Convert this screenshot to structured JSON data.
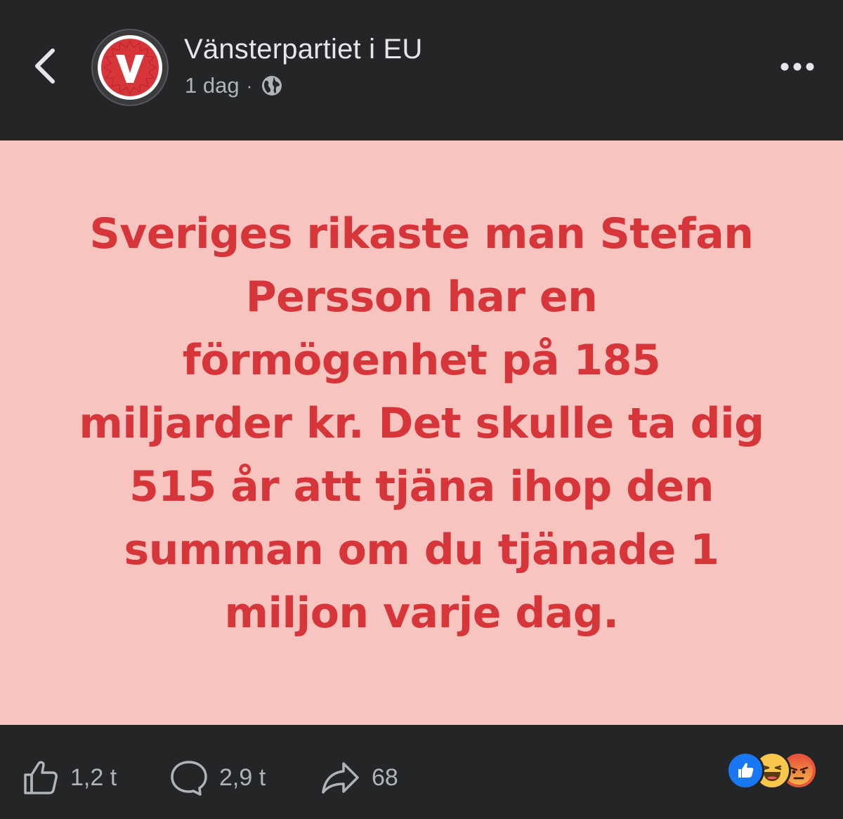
{
  "header": {
    "page_name": "Vänsterpartiet i EU",
    "time": "1 dag",
    "separator": "·",
    "privacy_icon": "globe-icon",
    "avatar_letter": "V",
    "back_icon": "chevron-left-icon",
    "more_icon": "more-horizontal-icon"
  },
  "post": {
    "background": "#f8c4c0",
    "text_color": "#d6353a",
    "lines": [
      "Sveriges rikaste man Stefan",
      "Persson har en",
      "förmögenhet på 185",
      "miljarder kr. Det skulle ta dig",
      "515 år att tjäna ihop den",
      "summan om du tjänade 1",
      "miljon varje dag."
    ]
  },
  "actions": {
    "likes": "1,2 t",
    "comments": "2,9 t",
    "shares": "68",
    "like_icon": "thumbs-up-icon",
    "comment_icon": "comment-bubble-icon",
    "share_icon": "share-arrow-icon"
  },
  "reactions": [
    "like",
    "haha",
    "angry"
  ],
  "colors": {
    "bar_background": "#242526",
    "brand_red": "#d6353a",
    "like_blue": "#1877f2",
    "muted_text": "#b0b3b8"
  }
}
